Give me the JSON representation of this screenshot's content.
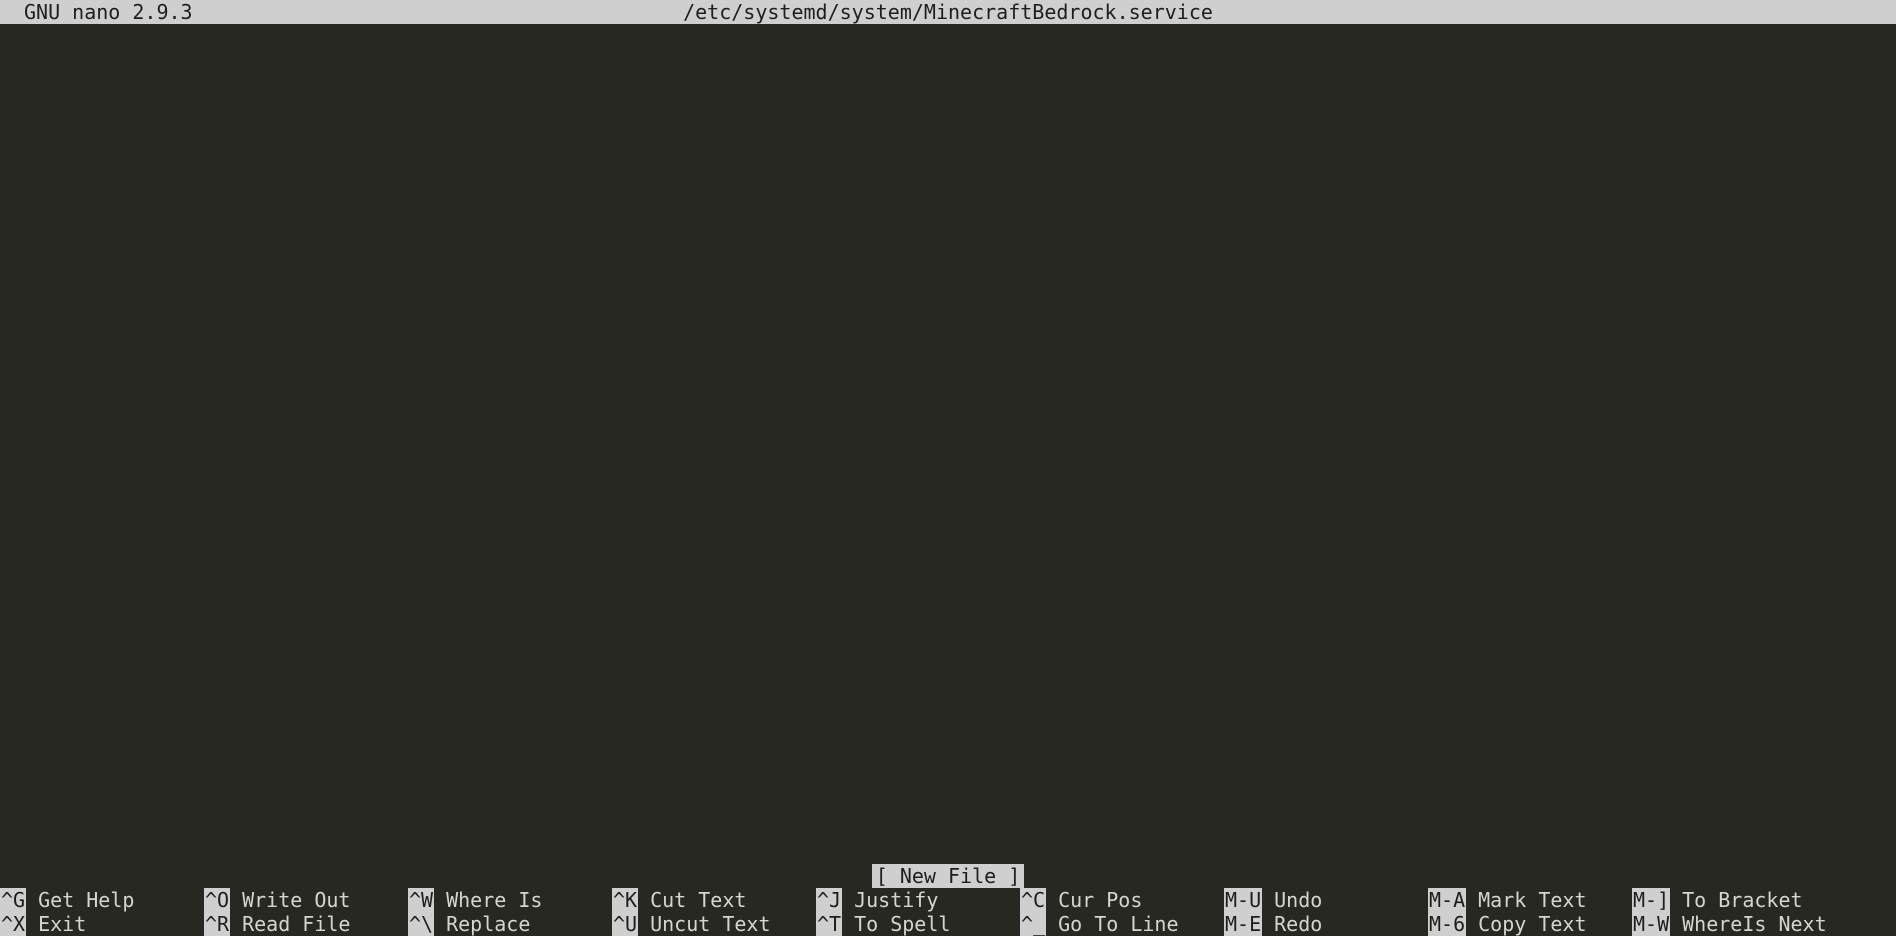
{
  "titlebar": {
    "version": "GNU nano 2.9.3",
    "filename": "/etc/systemd/system/MinecraftBedrock.service"
  },
  "status": {
    "message": "[ New File ]"
  },
  "shortcuts": {
    "row1": [
      {
        "key": "^G",
        "label": "Get Help"
      },
      {
        "key": "^O",
        "label": "Write Out"
      },
      {
        "key": "^W",
        "label": "Where Is"
      },
      {
        "key": "^K",
        "label": "Cut Text"
      },
      {
        "key": "^J",
        "label": "Justify"
      },
      {
        "key": "^C",
        "label": "Cur Pos"
      },
      {
        "key": "M-U",
        "label": "Undo"
      },
      {
        "key": "M-A",
        "label": "Mark Text"
      },
      {
        "key": "M-]",
        "label": "To Bracket"
      }
    ],
    "row2": [
      {
        "key": "^X",
        "label": "Exit"
      },
      {
        "key": "^R",
        "label": "Read File"
      },
      {
        "key": "^\\",
        "label": "Replace"
      },
      {
        "key": "^U",
        "label": "Uncut Text"
      },
      {
        "key": "^T",
        "label": "To Spell"
      },
      {
        "key": "^_",
        "label": "Go To Line"
      },
      {
        "key": "M-E",
        "label": "Redo"
      },
      {
        "key": "M-6",
        "label": "Copy Text"
      },
      {
        "key": "M-W",
        "label": "WhereIs Next"
      }
    ]
  }
}
